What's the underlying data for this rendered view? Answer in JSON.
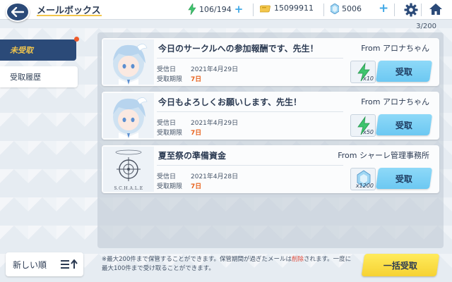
{
  "header": {
    "title": "メールボックス",
    "ap": "106/194",
    "credits": "15099911",
    "gems": "5006"
  },
  "counter": "3/200",
  "tabs": [
    {
      "label": "未受取",
      "active": true
    },
    {
      "label": "受取履歴",
      "active": false
    }
  ],
  "mails": [
    {
      "subject": "今日のサークルへの参加報酬です、先生！",
      "from": "From アロナちゃん",
      "date_label": "受信日",
      "date": "2021年4月29日",
      "limit_label": "受取期限",
      "limit": "7日",
      "reward_icon": "ap-energy-icon",
      "reward_qty": "x10",
      "button": "受取"
    },
    {
      "subject": "今日もよろしくお願いします、先生！",
      "from": "From アロナちゃん",
      "date_label": "受信日",
      "date": "2021年4月29日",
      "limit_label": "受取期限",
      "limit": "7日",
      "reward_icon": "ap-energy-icon",
      "reward_qty": "x50",
      "button": "受取"
    },
    {
      "subject": "夏至祭の準備資金",
      "from": "From シャーレ管理事務所",
      "date_label": "受信日",
      "date": "2021年4月28日",
      "limit_label": "受取期限",
      "limit": "7日",
      "reward_icon": "gem-icon",
      "reward_qty": "x1200",
      "button": "受取",
      "sender_logo_text": "S.C.H.A.L.E"
    }
  ],
  "sort": {
    "label": "新しい順"
  },
  "notice": {
    "part1": "※最大200件まで保管することができます。保管期間が過ぎたメールは",
    "highlight": "削除",
    "part2": "されます。一度に最大100件まで受け取ることができます。"
  },
  "bulk_button": "一括受取",
  "colors": {
    "nav_dark": "#2b4a78",
    "accent_yellow": "#f3c64c",
    "receive_blue": "#7ccff5",
    "warning_orange": "#e8631e",
    "bulk_yellow": "#f8d93a"
  }
}
